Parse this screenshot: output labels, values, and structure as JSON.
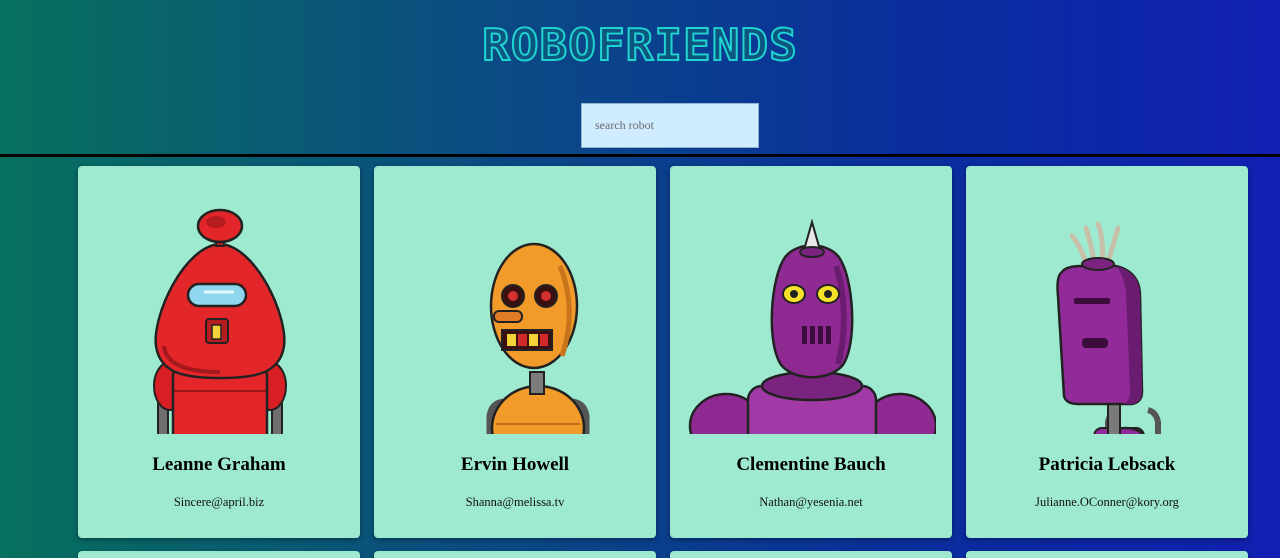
{
  "app": {
    "title": "ROBOFRIENDS"
  },
  "search": {
    "placeholder": "search robot",
    "value": ""
  },
  "robots": [
    {
      "name": "Leanne Graham",
      "email": "Sincere@april.biz",
      "color": "#e3262a"
    },
    {
      "name": "Ervin Howell",
      "email": "Shanna@melissa.tv",
      "color": "#f29a2a"
    },
    {
      "name": "Clementine Bauch",
      "email": "Nathan@yesenia.net",
      "color": "#8f2a93"
    },
    {
      "name": "Patricia Lebsack",
      "email": "Julianne.OConner@kory.org",
      "color": "#922b99"
    }
  ],
  "colors": {
    "card_bg": "#9eead1",
    "search_bg": "#d0ecff",
    "logo": "#20d4d2"
  }
}
